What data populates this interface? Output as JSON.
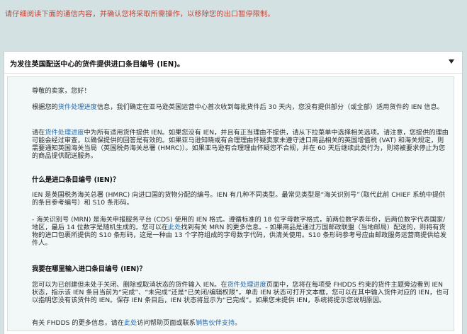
{
  "banner": {
    "warning": "请仔细阅读下面的通信内容，并确认您将采取所需操作，以移除您的出口暂停限制。"
  },
  "panel": {
    "title": "为发往英国配送中心的货件提供进口条目编号 (IEN)。",
    "caret_icon": "triangle-down-icon"
  },
  "content": {
    "greeting": "尊敬的卖家，您好！",
    "p1_before": "根据您的",
    "p1_link": "货件处理进度",
    "p1_after": "信息，我们确定在亚马逊英国运营中心首次收到每批货件后 30 天内，您没有提供部分（或全部）适用货件的 IEN 信息。",
    "p2_before": "请在",
    "p2_link": "货件处理进度",
    "p2_after": "中为所有适用货件提供 IEN。如果您没有 IEN，并且有正当理由不提供，请从下拉菜单中选择相关选项。请注意，您提供的理由可能会经过审查，以确保提供的回答是有效的。如果亚马逊知晓或有合理理由怀疑卖家未遵守进口商品相关的英国增值税 (VAT) 和海关规定，则需要通知英国海关当局（英国税务海关总署 (HMRC)）。如果亚马逊有合理理由怀疑您不合规，并在 60 天后继续此类行为，则将被要求停止为您的商品提供配送服务。",
    "h1": "什么是进口条目编号 (IEN)？",
    "p3": "IEN 是英国税务海关总署 (HMRC) 向进口国的货物分配的编号。IEN 有几种不同类型。最常见类型是“海关识别号”（取代此前 CHIEF 系统中提供的条目参考编号）和 S10 条形码。",
    "p4_before": "- 海关识别号 (MRN) 是海关申报服务平台 (CDS) 使用的 IEN 格式。遵循标准的 18 位字母数字格式，前两位数字表年份，后两位数字代表国家/地区，最后 14 位数字是随机生成的。您可以在",
    "p4_link": "此处",
    "p4_after": "找到有关 MRN 的更多信息。- 如果商品是通过万国邮政联盟（当地邮局）配送的，则将有货物的进口包裹所提供的 S10 条形码，这是一种由 13 个字符组成的字母数字代码，供清关使用。S10 条形码参考号应由邮政服务运营商提供给发件人。",
    "h2": "我要在哪里输入进口条目编号 (IEN)？",
    "p5_before": "您可以为已创建但未处于关闭、删除或取消状态的货件输入 IEN。在",
    "p5_link": "货件处理进度",
    "p5_after": "页面中，您将在每项受 FHDDS 约束的货件主题旁边看到 IEN 状态，指示该 IEN 条目当前为“完成”、“未完成”还是“已关闭/编辑权限”。单击 IEN 状态可打开文本框，您可以在其中输入货件对应的 IEN，也可以指明您没有该货件的 IEN。保存 IEN 条目后，IEN 状态将显示为“已完成”。如果您未提供 IEN，系统将提示您说明原因。",
    "p6_before": "有关 FHDDS 的更多信息，请在",
    "p6_link1": "此处",
    "p6_middle": "访问帮助页面或联系",
    "p6_link2": "销售伙伴支持",
    "p6_after": "。"
  }
}
